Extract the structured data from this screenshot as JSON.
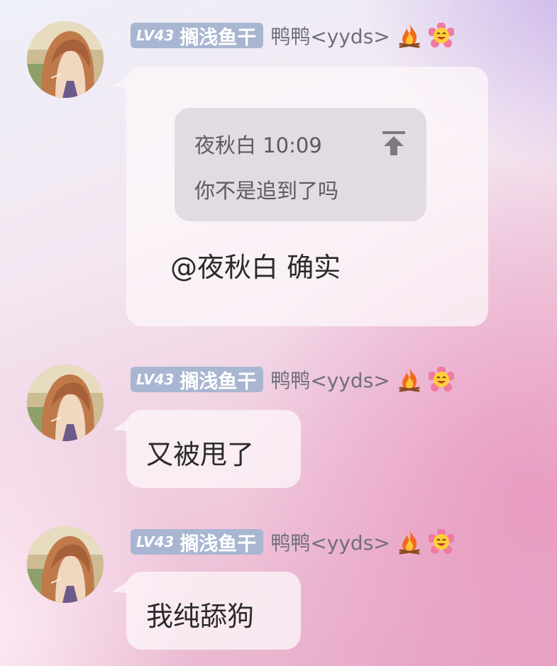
{
  "messages": [
    {
      "sender": {
        "level": "LV43",
        "title": "搁浅鱼干",
        "nickname": "鸭鸭<yyds>",
        "badges": [
          "fire-icon",
          "smile-flower-icon"
        ]
      },
      "quote": {
        "author": "夜秋白",
        "time": "10:09",
        "text": "你不是追到了吗"
      },
      "text": "@夜秋白 确实"
    },
    {
      "sender": {
        "level": "LV43",
        "title": "搁浅鱼干",
        "nickname": "鸭鸭<yyds>",
        "badges": [
          "fire-icon",
          "smile-flower-icon"
        ]
      },
      "text": "又被甩了"
    },
    {
      "sender": {
        "level": "LV43",
        "title": "搁浅鱼干",
        "nickname": "鸭鸭<yyds>",
        "badges": [
          "fire-icon",
          "smile-flower-icon"
        ]
      },
      "text": "我纯舔狗"
    }
  ],
  "colors": {
    "badge_bg": "#a9b6d2",
    "nickname": "#6f6f77",
    "bubble_bg": "#fdf6fa",
    "quote_bg": "#d2cdd4"
  }
}
